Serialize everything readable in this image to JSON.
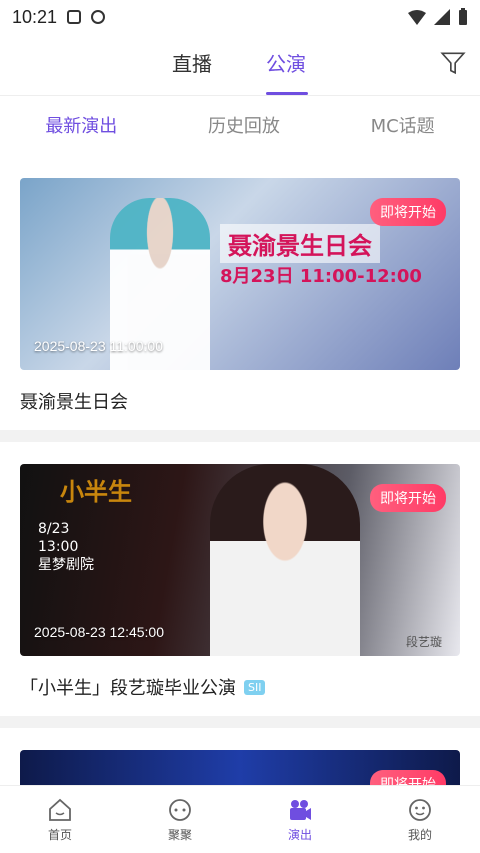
{
  "status": {
    "time": "10:21"
  },
  "topnav": {
    "tabs": [
      {
        "label": "直播"
      },
      {
        "label": "公演"
      }
    ]
  },
  "subtabs": [
    {
      "label": "最新演出"
    },
    {
      "label": "历史回放"
    },
    {
      "label": "MC话题"
    }
  ],
  "cards": [
    {
      "badge": "即将开始",
      "datetime": "2025-08-23 11:00:00",
      "poster_title": "聂渝景生日会",
      "poster_time": "8月23日 11:00-12:00",
      "title": "聂渝景生日会"
    },
    {
      "badge": "即将开始",
      "datetime": "2025-08-23 12:45:00",
      "poster_logo": "小半生",
      "poster_info": [
        "8/23",
        "13:00",
        "星梦剧院"
      ],
      "poster_sig": "段艺璇",
      "title": "「小半生」段艺璇毕业公演",
      "tag": "SII"
    },
    {
      "badge": "即将开始"
    }
  ],
  "bottomnav": [
    {
      "label": "首页"
    },
    {
      "label": "聚聚"
    },
    {
      "label": "演出"
    },
    {
      "label": "我的"
    }
  ],
  "colors": {
    "accent": "#6f4ee0",
    "badge": "#ff3b66"
  }
}
